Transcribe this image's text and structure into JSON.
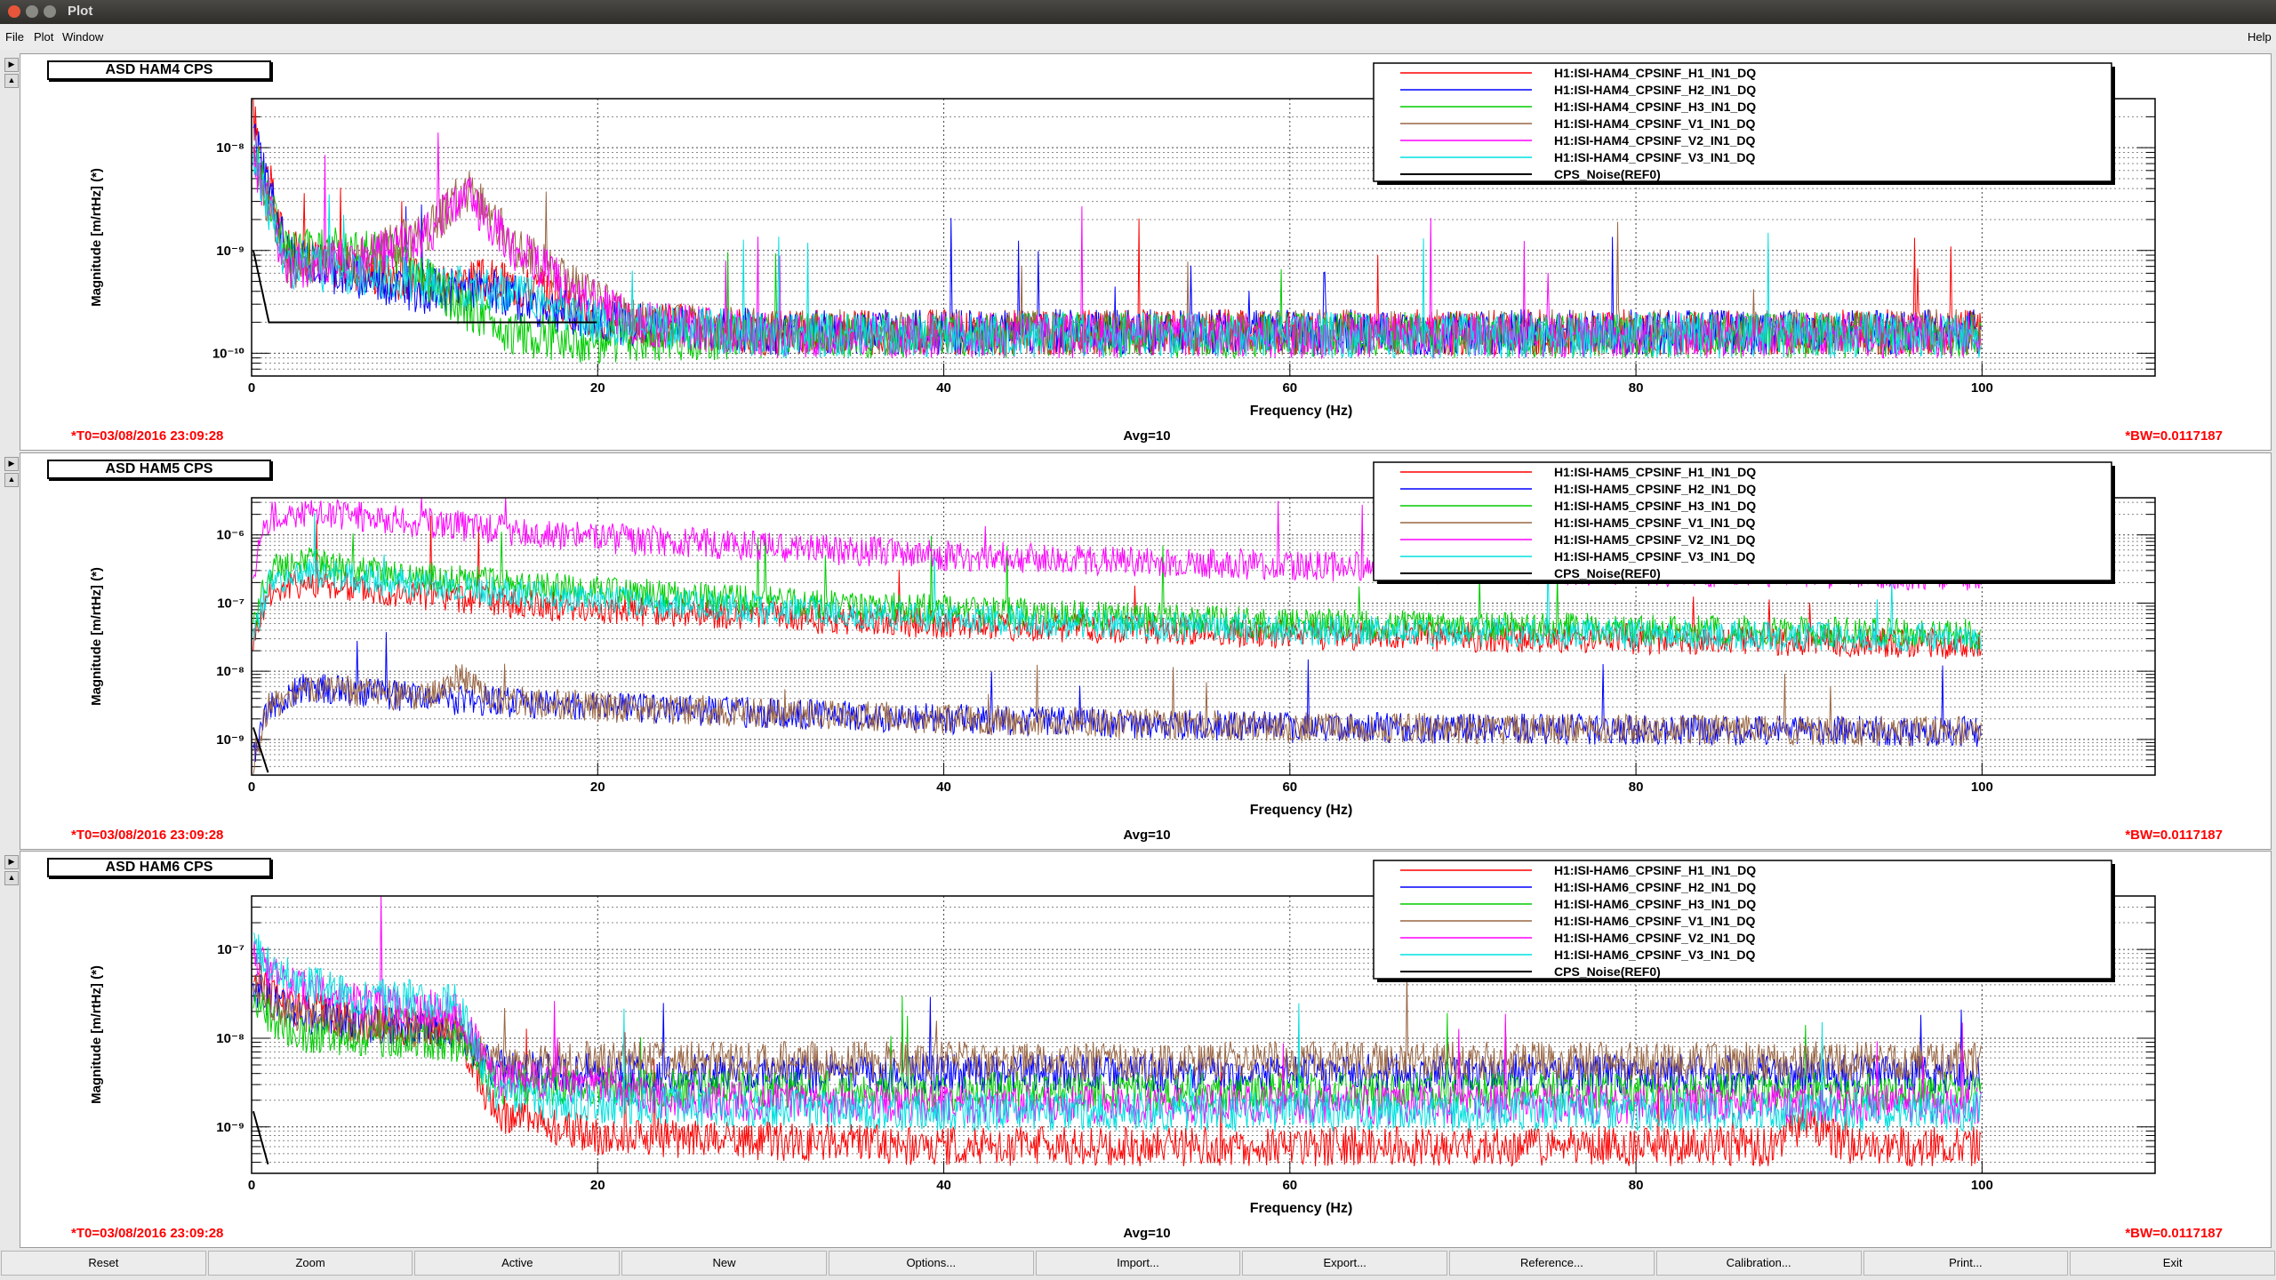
{
  "window": {
    "title": "Plot"
  },
  "menu": {
    "file": "File",
    "plot": "Plot",
    "window": "Window",
    "help": "Help"
  },
  "buttons": [
    "Reset",
    "Zoom",
    "Active",
    "New",
    "Options...",
    "Import...",
    "Export...",
    "Reference...",
    "Calibration...",
    "Print...",
    "Exit"
  ],
  "colors": {
    "H1": "#ff0000",
    "H2": "#0000ff",
    "H3": "#00cc00",
    "V1": "#996644",
    "V2": "#ff00ff",
    "V3": "#00e0e0",
    "REF": "#000000"
  },
  "chart_data": [
    {
      "type": "line",
      "title": "ASD HAM4 CPS",
      "xlabel": "Frequency (Hz)",
      "ylabel": "Magnitude [m/rtHz] (*)",
      "xlim": [
        0,
        110
      ],
      "ylim": [
        6e-11,
        3e-08
      ],
      "log_y": true,
      "x_ticks": [
        "0",
        "20",
        "40",
        "60",
        "80",
        "100"
      ],
      "y_ticks": [
        "10-8",
        "10-9",
        "10-10"
      ],
      "footer_left": "*T0=03/08/2016 23:09:28",
      "footer_center": "Avg=10",
      "footer_right": "*BW=0.0117187",
      "legend_position": "top-right",
      "series": [
        {
          "name": "H1:ISI-HAM4_CPSINF_H1_IN1_DQ",
          "color_key": "H1",
          "x": [
            0.1,
            2,
            5,
            10,
            14,
            17,
            20,
            30,
            60,
            100
          ],
          "y": [
            2e-08,
            1e-09,
            7e-10,
            5e-10,
            5e-10,
            4e-10,
            2e-10,
            1.6e-10,
            1.6e-10,
            1.6e-10
          ]
        },
        {
          "name": "H1:ISI-HAM4_CPSINF_H2_IN1_DQ",
          "color_key": "H2",
          "x": [
            0.1,
            2,
            5,
            10,
            14,
            20,
            30,
            60,
            100
          ],
          "y": [
            1.5e-08,
            1e-09,
            6e-10,
            4e-10,
            4e-10,
            2e-10,
            1.6e-10,
            1.6e-10,
            1.6e-10
          ]
        },
        {
          "name": "H1:ISI-HAM4_CPSINF_H3_IN1_DQ",
          "color_key": "H3",
          "x": [
            0.1,
            2,
            5,
            8,
            12,
            15,
            20,
            30,
            60,
            100
          ],
          "y": [
            1e-08,
            1e-09,
            1e-09,
            1e-09,
            3e-10,
            1.5e-10,
            1.3e-10,
            1.5e-10,
            1.5e-10,
            1.5e-10
          ]
        },
        {
          "name": "H1:ISI-HAM4_CPSINF_V1_IN1_DQ",
          "color_key": "V1",
          "x": [
            0.1,
            2,
            6,
            10,
            12.5,
            15,
            18,
            22,
            30,
            60,
            100
          ],
          "y": [
            8e-09,
            7e-10,
            8e-10,
            1.5e-09,
            4e-09,
            1.2e-09,
            5e-10,
            2e-10,
            1.6e-10,
            1.6e-10,
            1.6e-10
          ]
        },
        {
          "name": "H1:ISI-HAM4_CPSINF_V2_IN1_DQ",
          "color_key": "V2",
          "x": [
            0.1,
            2,
            6,
            10,
            12.5,
            15,
            18,
            22,
            30,
            60,
            100
          ],
          "y": [
            8e-09,
            7e-10,
            8e-10,
            1.4e-09,
            3.5e-09,
            1.1e-09,
            5e-10,
            2e-10,
            1.5e-10,
            1.5e-10,
            1.5e-10
          ]
        },
        {
          "name": "H1:ISI-HAM4_CPSINF_V3_IN1_DQ",
          "color_key": "V3",
          "x": [
            0.1,
            2,
            6,
            10,
            15,
            20,
            30,
            60,
            100
          ],
          "y": [
            8e-09,
            7e-10,
            6e-10,
            5e-10,
            4e-10,
            2e-10,
            1.5e-10,
            1.5e-10,
            1.5e-10
          ]
        },
        {
          "name": "CPS_Noise(REF0)",
          "color_key": "REF",
          "x": [
            0.1,
            1,
            20
          ],
          "y": [
            1e-09,
            2e-10,
            2e-10
          ]
        }
      ]
    },
    {
      "type": "line",
      "title": "ASD HAM5 CPS",
      "xlabel": "Frequency (Hz)",
      "ylabel": "Magnitude [m/rtHz] (*)",
      "xlim": [
        0,
        110
      ],
      "ylim": [
        3e-10,
        3.5e-06
      ],
      "log_y": true,
      "x_ticks": [
        "0",
        "20",
        "40",
        "60",
        "80",
        "100"
      ],
      "y_ticks": [
        "10-6",
        "10-7",
        "10-8",
        "10-9"
      ],
      "footer_left": "*T0=03/08/2016 23:09:28",
      "footer_center": "Avg=10",
      "footer_right": "*BW=0.0117187",
      "legend_position": "top-right",
      "series": [
        {
          "name": "H1:ISI-HAM5_CPSINF_H1_IN1_DQ",
          "color_key": "H1",
          "x": [
            0.1,
            1,
            3,
            10,
            20,
            40,
            60,
            100
          ],
          "y": [
            3e-08,
            1.5e-07,
            2e-07,
            1.3e-07,
            8e-08,
            5e-08,
            3.5e-08,
            2.5e-08
          ]
        },
        {
          "name": "H1:ISI-HAM5_CPSINF_H2_IN1_DQ",
          "color_key": "H2",
          "x": [
            0.1,
            1,
            3,
            10,
            20,
            40,
            60,
            100
          ],
          "y": [
            5e-10,
            3e-09,
            6e-09,
            4e-09,
            3e-09,
            2e-09,
            1.5e-09,
            1.3e-09
          ]
        },
        {
          "name": "H1:ISI-HAM5_CPSINF_H3_IN1_DQ",
          "color_key": "H3",
          "x": [
            0.1,
            1,
            3,
            10,
            20,
            40,
            60,
            100
          ],
          "y": [
            4e-08,
            3e-07,
            4e-07,
            2.5e-07,
            1.5e-07,
            8e-08,
            5e-08,
            3.5e-08
          ]
        },
        {
          "name": "H1:ISI-HAM5_CPSINF_V1_IN1_DQ",
          "color_key": "V1",
          "x": [
            0.1,
            1,
            3,
            10,
            12,
            14,
            20,
            40,
            60,
            100
          ],
          "y": [
            5e-10,
            3e-09,
            6e-09,
            4e-09,
            8e-09,
            4e-09,
            3e-09,
            2e-09,
            1.5e-09,
            1.3e-09
          ]
        },
        {
          "name": "H1:ISI-HAM5_CPSINF_V2_IN1_DQ",
          "color_key": "V2",
          "x": [
            0.1,
            1,
            3,
            10,
            20,
            40,
            60,
            100
          ],
          "y": [
            3e-07,
            1.8e-06,
            2.2e-06,
            1.5e-06,
            9e-07,
            5e-07,
            3.5e-07,
            2.5e-07
          ]
        },
        {
          "name": "H1:ISI-HAM5_CPSINF_V3_IN1_DQ",
          "color_key": "V3",
          "x": [
            0.1,
            1,
            3,
            10,
            20,
            40,
            60,
            100
          ],
          "y": [
            3e-08,
            2e-07,
            2.8e-07,
            1.8e-07,
            1.1e-07,
            6e-08,
            4e-08,
            3e-08
          ]
        },
        {
          "name": "CPS_Noise(REF0)",
          "color_key": "REF",
          "x": [
            0.1,
            1
          ],
          "y": [
            1.5e-09,
            3e-10
          ]
        }
      ]
    },
    {
      "type": "line",
      "title": "ASD HAM6 CPS",
      "xlabel": "Frequency (Hz)",
      "ylabel": "Magnitude [m/rtHz] (*)",
      "xlim": [
        0,
        110
      ],
      "ylim": [
        3e-10,
        4e-07
      ],
      "log_y": true,
      "x_ticks": [
        "0",
        "20",
        "40",
        "60",
        "80",
        "100"
      ],
      "y_ticks": [
        "10-7",
        "10-8",
        "10-9"
      ],
      "footer_left": "*T0=03/08/2016 23:09:28",
      "footer_center": "Avg=10",
      "footer_right": "*BW=0.0117187",
      "legend_position": "top-right",
      "series": [
        {
          "name": "H1:ISI-HAM6_CPSINF_H1_IN1_DQ",
          "color_key": "H1",
          "x": [
            0.1,
            2,
            6,
            12,
            14,
            20,
            30,
            40,
            88,
            90,
            92,
            100
          ],
          "y": [
            5e-08,
            2.5e-08,
            1.5e-08,
            1.2e-08,
            1.5e-09,
            8e-10,
            7e-10,
            6e-10,
            6e-10,
            1.2e-09,
            6e-10,
            6e-10
          ]
        },
        {
          "name": "H1:ISI-HAM6_CPSINF_H2_IN1_DQ",
          "color_key": "H2",
          "x": [
            0.1,
            2,
            6,
            12,
            14,
            20,
            40,
            100
          ],
          "y": [
            4e-08,
            2e-08,
            1.5e-08,
            1.2e-08,
            4.5e-09,
            4e-09,
            4e-09,
            4e-09
          ]
        },
        {
          "name": "H1:ISI-HAM6_CPSINF_H3_IN1_DQ",
          "color_key": "H3",
          "x": [
            0.1,
            2,
            6,
            12,
            14,
            20,
            40,
            100
          ],
          "y": [
            2.5e-08,
            1.2e-08,
            1e-08,
            9e-09,
            3e-09,
            2.8e-09,
            2.5e-09,
            2.5e-09
          ]
        },
        {
          "name": "H1:ISI-HAM6_CPSINF_V1_IN1_DQ",
          "color_key": "V1",
          "x": [
            0.1,
            2,
            6,
            12,
            14,
            20,
            40,
            100
          ],
          "y": [
            4e-08,
            2e-08,
            1.5e-08,
            1.3e-08,
            5.5e-09,
            5.5e-09,
            5.5e-09,
            5.5e-09
          ]
        },
        {
          "name": "H1:ISI-HAM6_CPSINF_V2_IN1_DQ",
          "color_key": "V2",
          "x": [
            0.1,
            2,
            6,
            12,
            14,
            20,
            24,
            40,
            100
          ],
          "y": [
            8e-08,
            4e-08,
            2.5e-08,
            2e-08,
            3.5e-09,
            3e-09,
            2e-09,
            1.8e-09,
            1.8e-09
          ]
        },
        {
          "name": "H1:ISI-HAM6_CPSINF_V3_IN1_DQ",
          "color_key": "V3",
          "x": [
            0.1,
            2,
            6,
            12,
            14,
            20,
            40,
            100
          ],
          "y": [
            1e-07,
            5e-08,
            3e-08,
            2.5e-08,
            2.2e-09,
            1.8e-09,
            1.5e-09,
            1.5e-09
          ]
        },
        {
          "name": "CPS_Noise(REF0)",
          "color_key": "REF",
          "x": [
            0.1,
            1
          ],
          "y": [
            1.5e-09,
            3.5e-10
          ]
        }
      ]
    }
  ]
}
